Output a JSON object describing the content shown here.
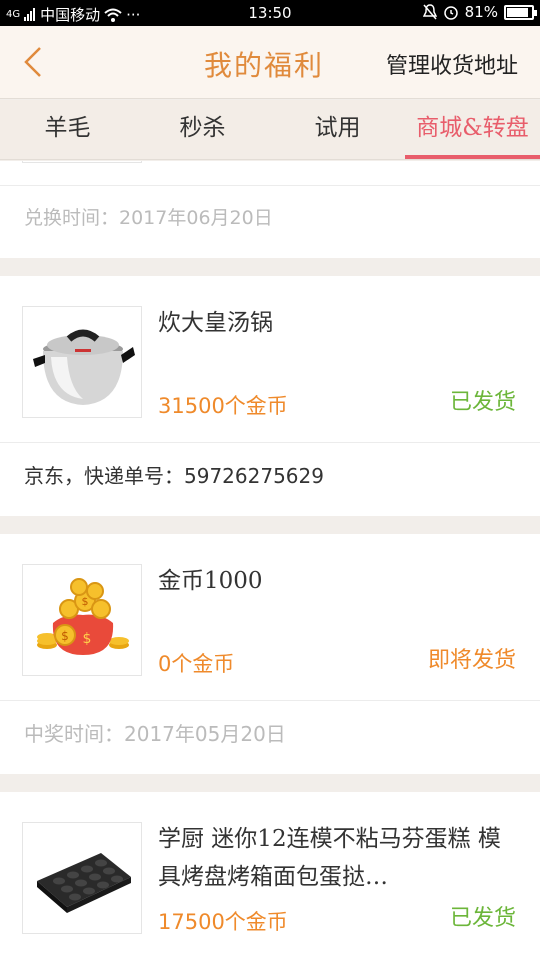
{
  "status_bar": {
    "carrier": "中国移动",
    "signal_label": "4G",
    "time": "13:50",
    "battery": "81%"
  },
  "header": {
    "title": "我的福利",
    "action": "管理收货地址"
  },
  "tabs": [
    {
      "label": "羊毛"
    },
    {
      "label": "秒杀"
    },
    {
      "label": "试用"
    },
    {
      "label": "商城&转盘",
      "active": true
    }
  ],
  "partial_item": {
    "date_text": "兑换时间：2017年06月20日"
  },
  "items": [
    {
      "name": "炊大皇汤锅",
      "price": "31500个金币",
      "status": "已发货",
      "status_color": "#6cb63a",
      "footer": "京东，快递单号：59726275629",
      "footer_color": "#333333",
      "image": "pot-image"
    },
    {
      "name": "金币1000",
      "price": "0个金币",
      "status": "即将发货",
      "status_color": "#ef8a2b",
      "footer": "中奖时间：2017年05月20日",
      "footer_color": "#bbbbbb",
      "image": "coin-bag-image"
    },
    {
      "name": "学厨 迷你12连模不粘马芬蛋糕 模具烤盘烤箱面包蛋挞…",
      "price": "17500个金币",
      "status": "已发货",
      "status_color": "#6cb63a",
      "footer": "",
      "footer_color": "#333333",
      "image": "muffin-tray-image"
    }
  ]
}
